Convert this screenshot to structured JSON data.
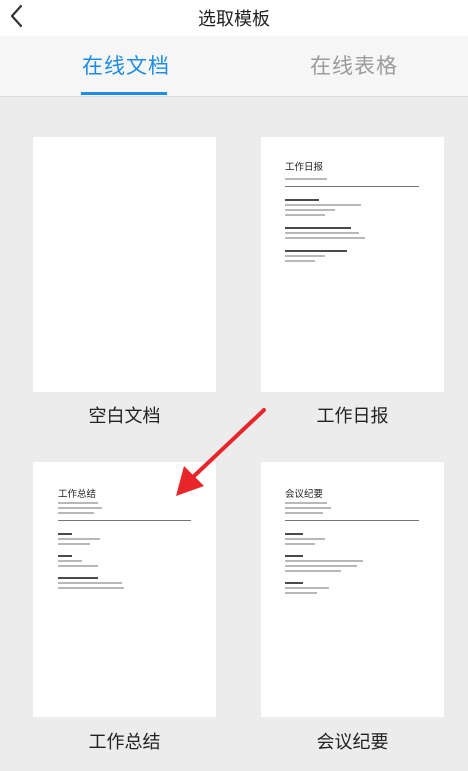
{
  "header": {
    "title": "选取模板"
  },
  "tabs": [
    {
      "label": "在线文档",
      "active": true
    },
    {
      "label": "在线表格",
      "active": false
    }
  ],
  "templates": [
    {
      "label": "空白文档",
      "preview_title": ""
    },
    {
      "label": "工作日报",
      "preview_title": "工作日报"
    },
    {
      "label": "工作总结",
      "preview_title": "工作总结"
    },
    {
      "label": "会议纪要",
      "preview_title": "会议纪要"
    }
  ],
  "colors": {
    "accent": "#1e8ce6",
    "arrow": "#e8262a",
    "inactive_tab": "#9b9b9b"
  },
  "icons": {
    "back": "chevron-left-icon",
    "annotation": "red-arrow-icon"
  }
}
